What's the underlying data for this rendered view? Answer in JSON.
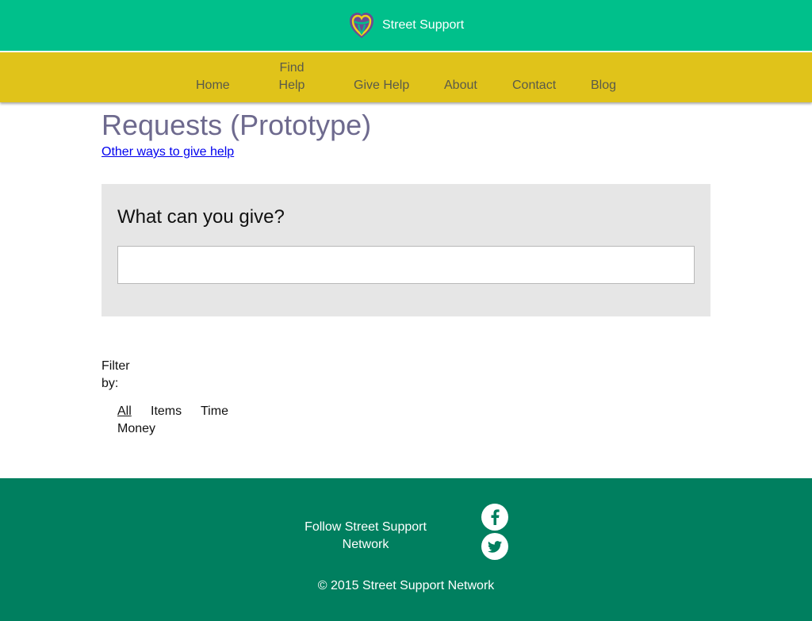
{
  "brand": {
    "name": "Street Support",
    "logo_icon": "street-support-heart-logo"
  },
  "colors": {
    "topbar": "#00c08b",
    "navbar": "#e0c31a",
    "footer": "#007f5f",
    "title": "#6e6a8e"
  },
  "nav": {
    "items": [
      {
        "label": "Home"
      },
      {
        "label": "Find Help"
      },
      {
        "label": "Give Help"
      },
      {
        "label": "About"
      },
      {
        "label": "Contact"
      },
      {
        "label": "Blog"
      }
    ]
  },
  "main": {
    "title": "Requests (Prototype)",
    "other_ways_link": "Other ways to give help",
    "give_heading": "What can you give?",
    "give_input_value": "",
    "filter_label": "Filter by:",
    "filters": [
      {
        "label": "All",
        "active": true
      },
      {
        "label": "Items"
      },
      {
        "label": "Time"
      },
      {
        "label": "Money"
      }
    ]
  },
  "footer": {
    "follow_text": "Follow Street Support Network",
    "social": [
      {
        "icon": "facebook-icon"
      },
      {
        "icon": "twitter-icon"
      }
    ],
    "copyright": "© 2015 Street Support Network"
  }
}
